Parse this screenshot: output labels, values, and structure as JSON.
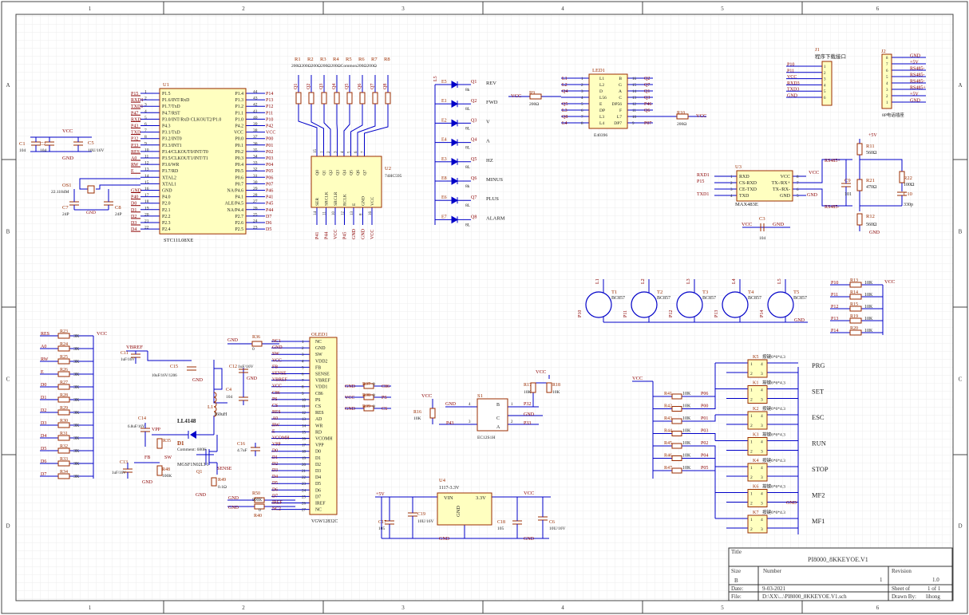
{
  "frame": {
    "col_labels": [
      "1",
      "2",
      "3",
      "4",
      "5",
      "6"
    ],
    "row_labels": [
      "A",
      "B",
      "C",
      "D"
    ]
  },
  "title_block": {
    "title_label": "Title",
    "title": "PI8000_8KKEYOE.V1",
    "size_label": "Size",
    "size": "B",
    "number_label": "Number",
    "number": "1",
    "revision_label": "Revision",
    "revision": "1.0",
    "date_label": "Date:",
    "date": "9-03-2021",
    "sheet_label": "Sheet  of",
    "sheet": "1 of 1",
    "file_label": "File:",
    "file": "D:\\XX\\...\\PI8000_8KKEYOE.V1.sch",
    "drawn_label": "Drawn By:",
    "drawn": "lihong"
  },
  "u1": {
    "ref": "U1",
    "part": "STC11L08XE",
    "left_pins": [
      {
        "net": "P15",
        "num": "1",
        "name": "P1.5"
      },
      {
        "net": "RXD1",
        "num": "2",
        "name": "P1.6/INT/RxD"
      },
      {
        "net": "TXD1",
        "num": "3",
        "name": "P1.7/TxD"
      },
      {
        "net": "P47",
        "num": "4",
        "name": "P4.7/RST"
      },
      {
        "net": "RXD",
        "num": "5",
        "name": "P3.0/INT/RxD CLKOUT2/P1.0"
      },
      {
        "net": "P43",
        "num": "6",
        "name": "P4.3"
      },
      {
        "net": "TXD",
        "num": "7",
        "name": "P3.1/TxD"
      },
      {
        "net": "P32",
        "num": "8",
        "name": "P3.2/INT0"
      },
      {
        "net": "P33",
        "num": "9",
        "name": "P3.3/INT1"
      },
      {
        "net": "RES",
        "num": "10",
        "name": "P3.4/CLKOUT0/INT/T0"
      },
      {
        "net": "A0",
        "num": "11",
        "name": "P3.5/CLKOUT1/INT/T1"
      },
      {
        "net": "RW",
        "num": "12",
        "name": "P3.6/WR"
      },
      {
        "net": "E",
        "num": "13",
        "name": "P3.7/RD"
      },
      {
        "net": "",
        "num": "14",
        "name": "XTAL2"
      },
      {
        "net": "",
        "num": "15",
        "name": "XTAL1"
      },
      {
        "net": "GND",
        "num": "16",
        "name": "GND"
      },
      {
        "net": "P40",
        "num": "17",
        "name": "P4.0"
      },
      {
        "net": "D0",
        "num": "18",
        "name": "P2.0"
      },
      {
        "net": "D1",
        "num": "19",
        "name": "P2.1"
      },
      {
        "net": "D2",
        "num": "20",
        "name": "P2.2"
      },
      {
        "net": "D3",
        "num": "21",
        "name": "P2.3"
      },
      {
        "net": "D4",
        "num": "22",
        "name": "P2.4"
      }
    ],
    "right_pins": [
      {
        "net": "P14",
        "num": "44",
        "name": "P1.4"
      },
      {
        "net": "P13",
        "num": "43",
        "name": "P1.3"
      },
      {
        "net": "P12",
        "num": "42",
        "name": "P1.2"
      },
      {
        "net": "P11",
        "num": "41",
        "name": "P1.1"
      },
      {
        "net": "P10",
        "num": "40",
        "name": "P1.0"
      },
      {
        "net": "P42",
        "num": "39",
        "name": "P4.2"
      },
      {
        "net": "VCC",
        "num": "38",
        "name": "VCC"
      },
      {
        "net": "P00",
        "num": "37",
        "name": "P0.0"
      },
      {
        "net": "P01",
        "num": "36",
        "name": "P0.1"
      },
      {
        "net": "P02",
        "num": "35",
        "name": "P0.2"
      },
      {
        "net": "P03",
        "num": "34",
        "name": "P0.3"
      },
      {
        "net": "P04",
        "num": "33",
        "name": "P0.4"
      },
      {
        "net": "P05",
        "num": "32",
        "name": "P0.5"
      },
      {
        "net": "P06",
        "num": "31",
        "name": "P0.6"
      },
      {
        "net": "P07",
        "num": "30",
        "name": "P0.7"
      },
      {
        "net": "P46",
        "num": "29",
        "name": "NA/P4.6"
      },
      {
        "net": "P41",
        "num": "28",
        "name": "P4.1"
      },
      {
        "net": "P45",
        "num": "27",
        "name": "ALE/P4.5"
      },
      {
        "net": "P44",
        "num": "26",
        "name": "NA/P4.4"
      },
      {
        "net": "D7",
        "num": "25",
        "name": "P2.7"
      },
      {
        "net": "D6",
        "num": "24",
        "name": "P2.6"
      },
      {
        "net": "D5",
        "num": "23",
        "name": "P2.5"
      }
    ]
  },
  "osc": {
    "c1": "C1",
    "c1v": "104",
    "c2": "C2",
    "c2v": "104",
    "c5": "C5",
    "c5v": "10U/16V",
    "vcc": "VCC",
    "gnd": "GND",
    "os1": "OS1",
    "os1v": "22.1184M",
    "c7": "C7",
    "c7v": "24P",
    "c8": "C8",
    "c8v": "24P"
  },
  "res_array": {
    "refs": [
      "R1",
      "R2",
      "R3",
      "R4",
      "R5",
      "R6",
      "R7",
      "R8"
    ],
    "values_line": "200Ω200Ω200Ω200Ω200ΩCommon200Ω200Ω",
    "nets": [
      "Q1",
      "Q2",
      "Q3",
      "Q4",
      "Q5",
      "Q6",
      "Q7",
      "Q8"
    ]
  },
  "u2": {
    "ref": "U2",
    "part": "74HC595",
    "top_pins": [
      "Q0",
      "Q1",
      "Q2",
      "Q3",
      "Q4",
      "Q5",
      "Q6",
      "Q7"
    ],
    "top_nums": [
      "15",
      "1",
      "2",
      "3",
      "4",
      "5",
      "6",
      "7"
    ],
    "bottom_pins": [
      "SER",
      "SRCLK",
      "SRCLR",
      "RCLK",
      "E",
      "GND",
      "VCC"
    ],
    "bottom_nums": [
      "14",
      "11",
      "10",
      "12",
      "13",
      "8",
      "16"
    ],
    "bottom_nets": [
      "P41",
      "P44",
      "VCC",
      "P45",
      "GND",
      "GND",
      "VCC"
    ]
  },
  "leds": {
    "supply": "L5",
    "items": [
      {
        "ref": "E5",
        "net": "Q1",
        "label": "REV",
        "code": "8k"
      },
      {
        "ref": "E1",
        "net": "Q2",
        "label": "FWD",
        "code": "8L"
      },
      {
        "ref": "E2",
        "net": "Q3",
        "label": "V",
        "code": "8L"
      },
      {
        "ref": "E4",
        "net": "Q4",
        "label": "A",
        "code": "8L"
      },
      {
        "ref": "E3",
        "net": "Q5",
        "label": "HZ",
        "code": "8L"
      },
      {
        "ref": "E8",
        "net": "Q6",
        "label": "MINUS",
        "code": "8k"
      },
      {
        "ref": "E6",
        "net": "Q7",
        "label": "PLUS",
        "code": "8L"
      },
      {
        "ref": "E7",
        "net": "Q8",
        "label": "ALARM",
        "code": "8L"
      }
    ]
  },
  "led1": {
    "ref": "LED1",
    "part": "E40396",
    "vcc": "VCC",
    "r9": "R9",
    "r9v": "200Ω",
    "r10": "R10",
    "r10v": "200Ω",
    "left_nets": [
      "L1",
      "L2",
      "Q4",
      "",
      "Q5",
      "L3",
      "Q8",
      "L4"
    ],
    "left_nums": [
      "1",
      "2",
      "3",
      "4",
      "5",
      "6",
      "7",
      "8"
    ],
    "left_names": [
      "L1",
      "L2",
      "D",
      "L56",
      "E",
      "DP",
      "L3",
      "L4"
    ],
    "right_names": [
      "B",
      "G",
      "A",
      "C",
      "DP56",
      "F",
      "L7",
      "DP7"
    ],
    "right_nums": [
      "16",
      "15",
      "14",
      "13",
      "12",
      "11",
      "10",
      "9"
    ],
    "right_nets": [
      "Q2",
      "Q7",
      "Q1",
      "Q3",
      "P46",
      "Q6",
      "",
      "P07"
    ]
  },
  "j1": {
    "ref": "J1",
    "title": "程序下载接口",
    "nets": [
      "P10",
      "P11",
      "VCC",
      "RXD3",
      "TXD3",
      "GND"
    ],
    "nums": [
      "1",
      "2",
      "3",
      "4",
      "5",
      "6"
    ]
  },
  "j2": {
    "ref": "J2",
    "title": "8P电话插座",
    "nets": [
      "GND",
      "+5V",
      "RS485-",
      "RS485-",
      "RS485-",
      "RS485+",
      "+5V",
      "GND"
    ],
    "nums": [
      "8",
      "7",
      "6",
      "5",
      "4",
      "3",
      "2",
      "1"
    ]
  },
  "u3": {
    "ref": "U3",
    "part": "MAX483E",
    "left": [
      "RXD",
      "CS-RXD",
      "CE-TXD",
      "TXD"
    ],
    "left_nums": [
      "1",
      "2",
      "3",
      "4"
    ],
    "left_nets": [
      "RXD1",
      "P15",
      "",
      "TXD1"
    ],
    "right": [
      "VCC",
      "TX-/RX+",
      "TX-/RX-",
      "GND"
    ],
    "right_nums": [
      "8",
      "7",
      "6",
      "5"
    ],
    "right_nets": [
      "VCC",
      "",
      "",
      ""
    ],
    "rs_pos": "RS485+",
    "rs_neg": "RS485-",
    "plus5": "+5V",
    "r11": "R11",
    "r11v": "560Ω",
    "r12": "R12",
    "r12v": "560Ω",
    "r21": "R21",
    "r21v": "470Ω",
    "r22": "R22",
    "r22v": "100Ω",
    "c9": "C9",
    "c9v": "101",
    "c10": "C10",
    "c10v": "330p",
    "c3": "C3",
    "c3v": "104",
    "vcc": "VCC",
    "gnd": "GND"
  },
  "transistors": {
    "part": "BC857",
    "items": [
      {
        "ref": "T1",
        "net": "P10"
      },
      {
        "ref": "T2",
        "net": "P11"
      },
      {
        "ref": "T3",
        "net": "P12"
      },
      {
        "ref": "T4",
        "net": "P13"
      },
      {
        "ref": "T5",
        "net": "P14"
      }
    ],
    "gnd": "GND"
  },
  "pullups": {
    "items": [
      {
        "net": "P10",
        "ref": "R13",
        "val": "10K"
      },
      {
        "net": "P11",
        "ref": "R14",
        "val": "10K"
      },
      {
        "net": "P12",
        "ref": "R15",
        "val": "10K"
      },
      {
        "net": "P13",
        "ref": "R19",
        "val": "10K"
      },
      {
        "net": "P14",
        "ref": "R20",
        "val": "10K"
      }
    ],
    "vcc": "VCC"
  },
  "left_res": {
    "items": [
      {
        "net": "RES",
        "ref": "R23",
        "val": "3K"
      },
      {
        "net": "A0",
        "ref": "R24",
        "val": "3K"
      },
      {
        "net": "RW",
        "ref": "R25",
        "val": "3K"
      },
      {
        "net": "E",
        "ref": "R26",
        "val": "3K"
      },
      {
        "net": "D0",
        "ref": "R27",
        "val": "3K"
      },
      {
        "net": "D1",
        "ref": "R28",
        "val": "3K"
      },
      {
        "net": "D2",
        "ref": "R29",
        "val": "3K"
      },
      {
        "net": "D3",
        "ref": "R30",
        "val": "3K"
      },
      {
        "net": "D4",
        "ref": "R31",
        "val": "3K"
      },
      {
        "net": "D5",
        "ref": "R32",
        "val": "3K"
      },
      {
        "net": "D6",
        "ref": "R33",
        "val": "3K"
      },
      {
        "net": "D7",
        "ref": "R34",
        "val": "3K"
      }
    ],
    "vcc": "VCC"
  },
  "boost": {
    "vbref": "VBREF",
    "c11": "C11",
    "c11v": "1uF/16V",
    "c15": "C15",
    "c15v": "10uF/16V/1206",
    "gnd": "GND",
    "r36": "R36",
    "r36v": "0",
    "c12": "C12",
    "c12v": "1uF/16V",
    "c4": "C4",
    "c4v": "104",
    "l1": "L1",
    "l1v": "160uH",
    "d1": "D1",
    "d1v": "LL4148",
    "comment": "Comment: 680K",
    "c14": "C14",
    "c14v": "6.8uF/16V",
    "vpp": "VPP",
    "fb": "FB",
    "sw": "SW",
    "r35": "R35",
    "r48": "R48",
    "r48v": "100K",
    "c13": "C13",
    "c13v": "1uF/16V",
    "q1": "Q1",
    "q1v": "MGSF1N02LT1",
    "sense": "SENSE",
    "r49": "R49",
    "r49v": "0.1Ω",
    "c16": "C16",
    "c16v": "4.7uF",
    "r50": "R50",
    "r50v": "900K",
    "r40": "R40",
    "r40v": "0"
  },
  "oled": {
    "ref": "OLED1",
    "part": "VGW12832C",
    "pins": [
      "NC",
      "GND",
      "SW",
      "VDD2",
      "FB",
      "SENSE",
      "VBREF",
      "VDD1",
      "C86",
      "PS",
      "CS",
      "RES",
      "AD",
      "WR",
      "RD",
      "VCOMH",
      "VPP",
      "D0",
      "D1",
      "D2",
      "D3",
      "D4",
      "D5",
      "D6",
      "D7",
      "IREF",
      "NC"
    ],
    "nets": [
      "NC1",
      "GND",
      "SW",
      "VCC",
      "FB",
      "SENSE",
      "VBREF",
      "VCC",
      "C86",
      "PS",
      "CS",
      "RES",
      "A0",
      "RW",
      "E",
      "VCOMH",
      "VPP",
      "D0",
      "D1",
      "D2",
      "D3",
      "D4",
      "D5",
      "D6",
      "D7",
      "IREF",
      "NC2"
    ]
  },
  "r37_39": {
    "items": [
      {
        "l": "GND",
        "ref": "R37",
        "val": "0",
        "n": "C86"
      },
      {
        "l": "VCC",
        "ref": "R38",
        "val": "0",
        "n": "PS"
      },
      {
        "l": "GND",
        "ref": "R39",
        "val": "0",
        "n": "CS"
      }
    ]
  },
  "s1": {
    "ref": "S1",
    "part": "EC12S1H",
    "vcc": "VCC",
    "r16": "R16",
    "r16v": "10K",
    "r17": "R17",
    "r17v": "10K",
    "r18": "R18",
    "r18v": "10K",
    "gnd": "GND",
    "p43": "P43",
    "p32": "P32",
    "p33": "P33",
    "pins": [
      "B",
      "A",
      "C"
    ],
    "nums": [
      "4",
      "3",
      "1",
      "2"
    ]
  },
  "u4": {
    "ref": "U4",
    "part": "1117-3.3V",
    "vin": "VIN",
    "vout": "3.3V",
    "gnd": "GND",
    "plus5": "+5V",
    "vcc": "VCC",
    "c17": "C17",
    "c17v": "105",
    "c19": "C19",
    "c19v": "10U/16V",
    "c18": "C18",
    "c18v": "105",
    "c6": "C6",
    "c6v": "10U/16V"
  },
  "keys": {
    "vcc": "VCC",
    "gnd": "GND",
    "switch": "按键6*6*4.3",
    "items": [
      {
        "ref": "K5",
        "res": "R41",
        "rv": "10K",
        "net": "P06",
        "label": "PRG"
      },
      {
        "ref": "K1",
        "res": "R42",
        "rv": "10K",
        "net": "P00",
        "label": "SET"
      },
      {
        "ref": "K2",
        "res": "R43",
        "rv": "10K",
        "net": "P01",
        "label": "ESC"
      },
      {
        "ref": "K3",
        "res": "R44",
        "rv": "10K",
        "net": "P03",
        "label": "RUN"
      },
      {
        "ref": "K4",
        "res": "R45",
        "rv": "10K",
        "net": "P02",
        "label": "STOP"
      },
      {
        "ref": "K6",
        "res": "R46",
        "rv": "10K",
        "net": "P04",
        "label": "MF2"
      },
      {
        "ref": "K7",
        "res": "R47",
        "rv": "10K",
        "net": "P05",
        "label": "MF1"
      }
    ]
  },
  "colors": {
    "wire": "#0000c8",
    "part": "#9b2d00",
    "net": "#8b0000",
    "body": "#ffffc0",
    "grid": "#ececec",
    "frame": "#444444"
  }
}
